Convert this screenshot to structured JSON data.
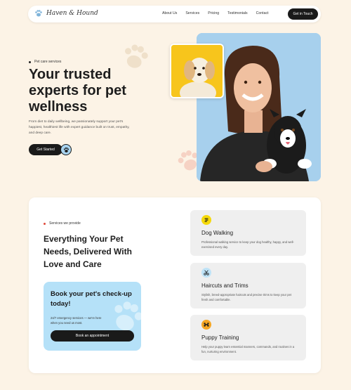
{
  "nav": {
    "brand": "Haven & Hound",
    "links": [
      "About Us",
      "Services",
      "Pricing",
      "Testimonials",
      "Contact"
    ],
    "cta": "Get in Touch"
  },
  "hero": {
    "tag": "Pet care services",
    "title": "Your trusted experts for pet wellness",
    "description": "From diet to daily wellbeing, we passionately support your pet's happiest, healthiest life with expert guidance built on trust, empathy, and deep care.",
    "button": "Get Started"
  },
  "services": {
    "tag": "Services we provide",
    "title": "Everything Your Pet Needs, Delivered With Love and Care",
    "booking": {
      "title": "Book your pet's check-up today!",
      "description": "24/7 emergency services — we're here when you need us most.",
      "button": "Book an appointment"
    },
    "items": [
      {
        "name": "Dog Walking",
        "description": "Professional walking service to keep your dog healthy, happy, and well-exercised every day.",
        "icon": "walking-icon",
        "icon_color": "#f5d90a"
      },
      {
        "name": "Haircuts and Trims",
        "description": "Stylish, breed-appropriate haircuts and precise trims to keep your pet fresh and comfortable.",
        "icon": "scissors-icon",
        "icon_color": "#bfe3f7"
      },
      {
        "name": "Puppy Training",
        "description": "Help your puppy learn essential manners, commands, and routines in a fun, nurturing environment.",
        "icon": "training-icon",
        "icon_color": "#f5a623"
      }
    ]
  },
  "colors": {
    "background": "#fcf3e6",
    "accent_blue": "#a7d0ed",
    "accent_yellow": "#f7c51c",
    "dark": "#1a1a1a"
  }
}
